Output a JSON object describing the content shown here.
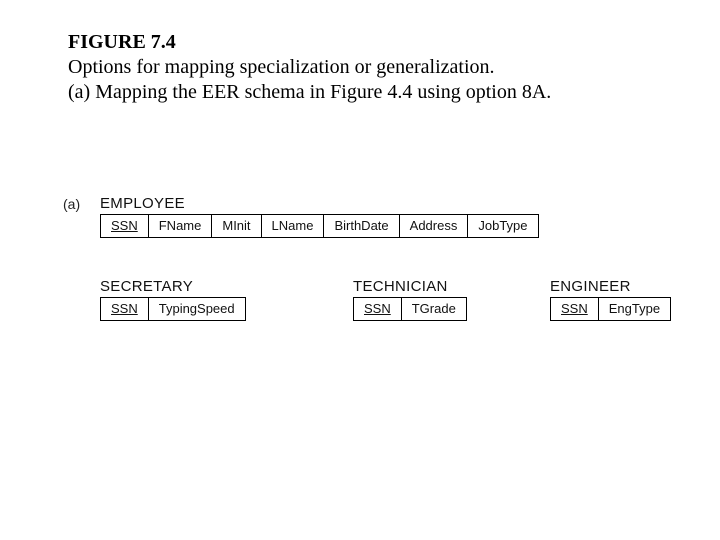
{
  "caption": {
    "figure_number": "FIGURE 7.4",
    "line1": "Options for mapping specialization or generalization.",
    "line2": "(a) Mapping the EER schema in Figure 4.4 using option 8A."
  },
  "subpart_label": "(a)",
  "relations": {
    "employee": {
      "name": "EMPLOYEE",
      "attrs": [
        "SSN",
        "FName",
        "MInit",
        "LName",
        "BirthDate",
        "Address",
        "JobType"
      ],
      "pk_index": 0
    },
    "secretary": {
      "name": "SECRETARY",
      "attrs": [
        "SSN",
        "TypingSpeed"
      ],
      "pk_index": 0
    },
    "technician": {
      "name": "TECHNICIAN",
      "attrs": [
        "SSN",
        "TGrade"
      ],
      "pk_index": 0
    },
    "engineer": {
      "name": "ENGINEER",
      "attrs": [
        "SSN",
        "EngType"
      ],
      "pk_index": 0
    }
  }
}
